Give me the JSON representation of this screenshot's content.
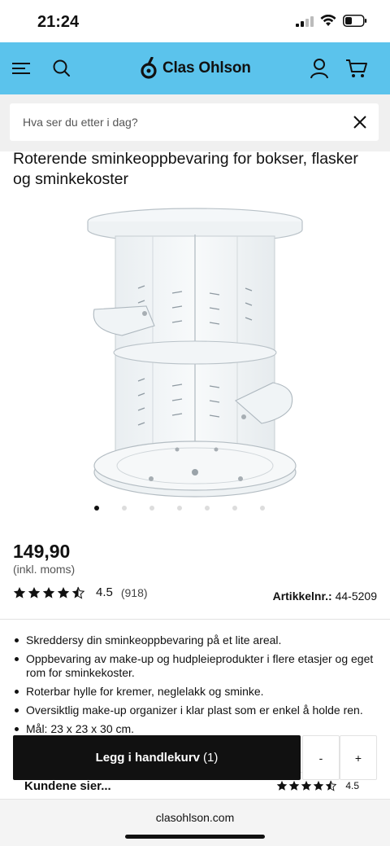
{
  "status_bar": {
    "time": "21:24"
  },
  "header": {
    "logo_text": "Clas Ohlson",
    "colors": {
      "background": "#5bc3ec"
    },
    "icons": [
      "menu-icon",
      "search-icon",
      "user-icon",
      "cart-icon"
    ]
  },
  "search": {
    "placeholder": "Hva ser du etter i dag?"
  },
  "product": {
    "title": "Roterende sminkeoppbevaring for bokser, flasker og sminkekoster",
    "image_slides": 7,
    "active_slide": 1,
    "price": "149,90",
    "vat_note": "(inkl. moms)",
    "rating_value": "4.5",
    "rating_stars": 4.5,
    "rating_count": "(918)",
    "article_label": "Artikkelnr.:",
    "article_number": "44-5209",
    "features": [
      "Skreddersy din sminkeoppbevaring på et lite areal.",
      "Oppbevaring av make-up og hudpleieprodukter i flere etasjer og eget rom for sminkekoster.",
      "Roterbar hylle for kremer, neglelakk og sminke.",
      "Oversiktlig make-up organizer i klar plast som er enkel å holde ren.",
      "Mål: 23 x 23 x 30 cm."
    ]
  },
  "cart": {
    "add_label": "Legg i handlekurv",
    "quantity": "(1)",
    "minus_label": "-",
    "plus_label": "+"
  },
  "customers": {
    "label": "Kundene sier...",
    "value": "4.5"
  },
  "browser": {
    "url": "clasohlson.com"
  }
}
